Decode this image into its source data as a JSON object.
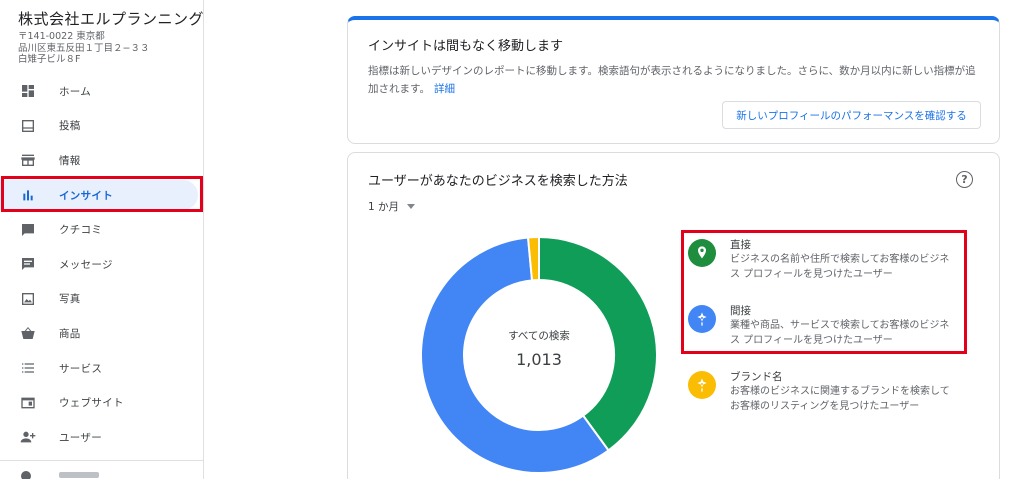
{
  "business": {
    "name": "株式会社エルプランニング",
    "address": "〒141-0022 東京都\n品川区東五反田１丁目２−３３\n白雉子ビル８F"
  },
  "sidebar": {
    "items": [
      {
        "label": "ホーム",
        "icon": "dashboard-icon"
      },
      {
        "label": "投稿",
        "icon": "post-icon"
      },
      {
        "label": "情報",
        "icon": "store-icon"
      },
      {
        "label": "インサイト",
        "icon": "bar-chart-icon",
        "active": true
      },
      {
        "label": "クチコミ",
        "icon": "review-icon"
      },
      {
        "label": "メッセージ",
        "icon": "message-icon"
      },
      {
        "label": "写真",
        "icon": "photo-icon"
      },
      {
        "label": "商品",
        "icon": "basket-icon"
      },
      {
        "label": "サービス",
        "icon": "list-icon"
      },
      {
        "label": "ウェブサイト",
        "icon": "website-icon"
      },
      {
        "label": "ユーザー",
        "icon": "add-user-icon"
      }
    ]
  },
  "notice": {
    "title": "インサイトは間もなく移動します",
    "body": "指標は新しいデザインのレポートに移動します。検索語句が表示されるようになりました。さらに、数か月以内に新しい指標が追加されます。",
    "link": "詳細",
    "button": "新しいプロフィールのパフォーマンスを確認する"
  },
  "search_card": {
    "title": "ユーザーがあなたのビジネスを検索した方法",
    "period": "1 か月",
    "center_label": "すべての検索",
    "center_value": "1,013",
    "legend": [
      {
        "title": "直接",
        "desc": "ビジネスの名前や住所で検索してお客様のビジネス プロフィールを見つけたユーザー",
        "color": "#1e8e3e",
        "icon": "location-pin-icon"
      },
      {
        "title": "間接",
        "desc": "業種や商品、サービスで検索してお客様のビジネス プロフィールを見つけたユーザー",
        "color": "#4285f4",
        "icon": "discovery-icon"
      },
      {
        "title": "ブランド名",
        "desc": "お客様のビジネスに関連するブランドを検索してお客様のリスティングを見つけたユーザー",
        "color": "#fbbc04",
        "icon": "brand-icon"
      }
    ]
  },
  "chart_data": {
    "type": "pie",
    "center_label": "すべての検索",
    "total": 1013,
    "categories": [
      "直接",
      "間接",
      "ブランド名"
    ],
    "values": [
      405,
      593,
      15
    ],
    "colors": [
      "#0f9d58",
      "#4285f4",
      "#fbbc04"
    ]
  },
  "colors": {
    "accent": "#1a73e8",
    "active_bg": "#e8f0fe",
    "highlight_box": "#e2001a"
  }
}
